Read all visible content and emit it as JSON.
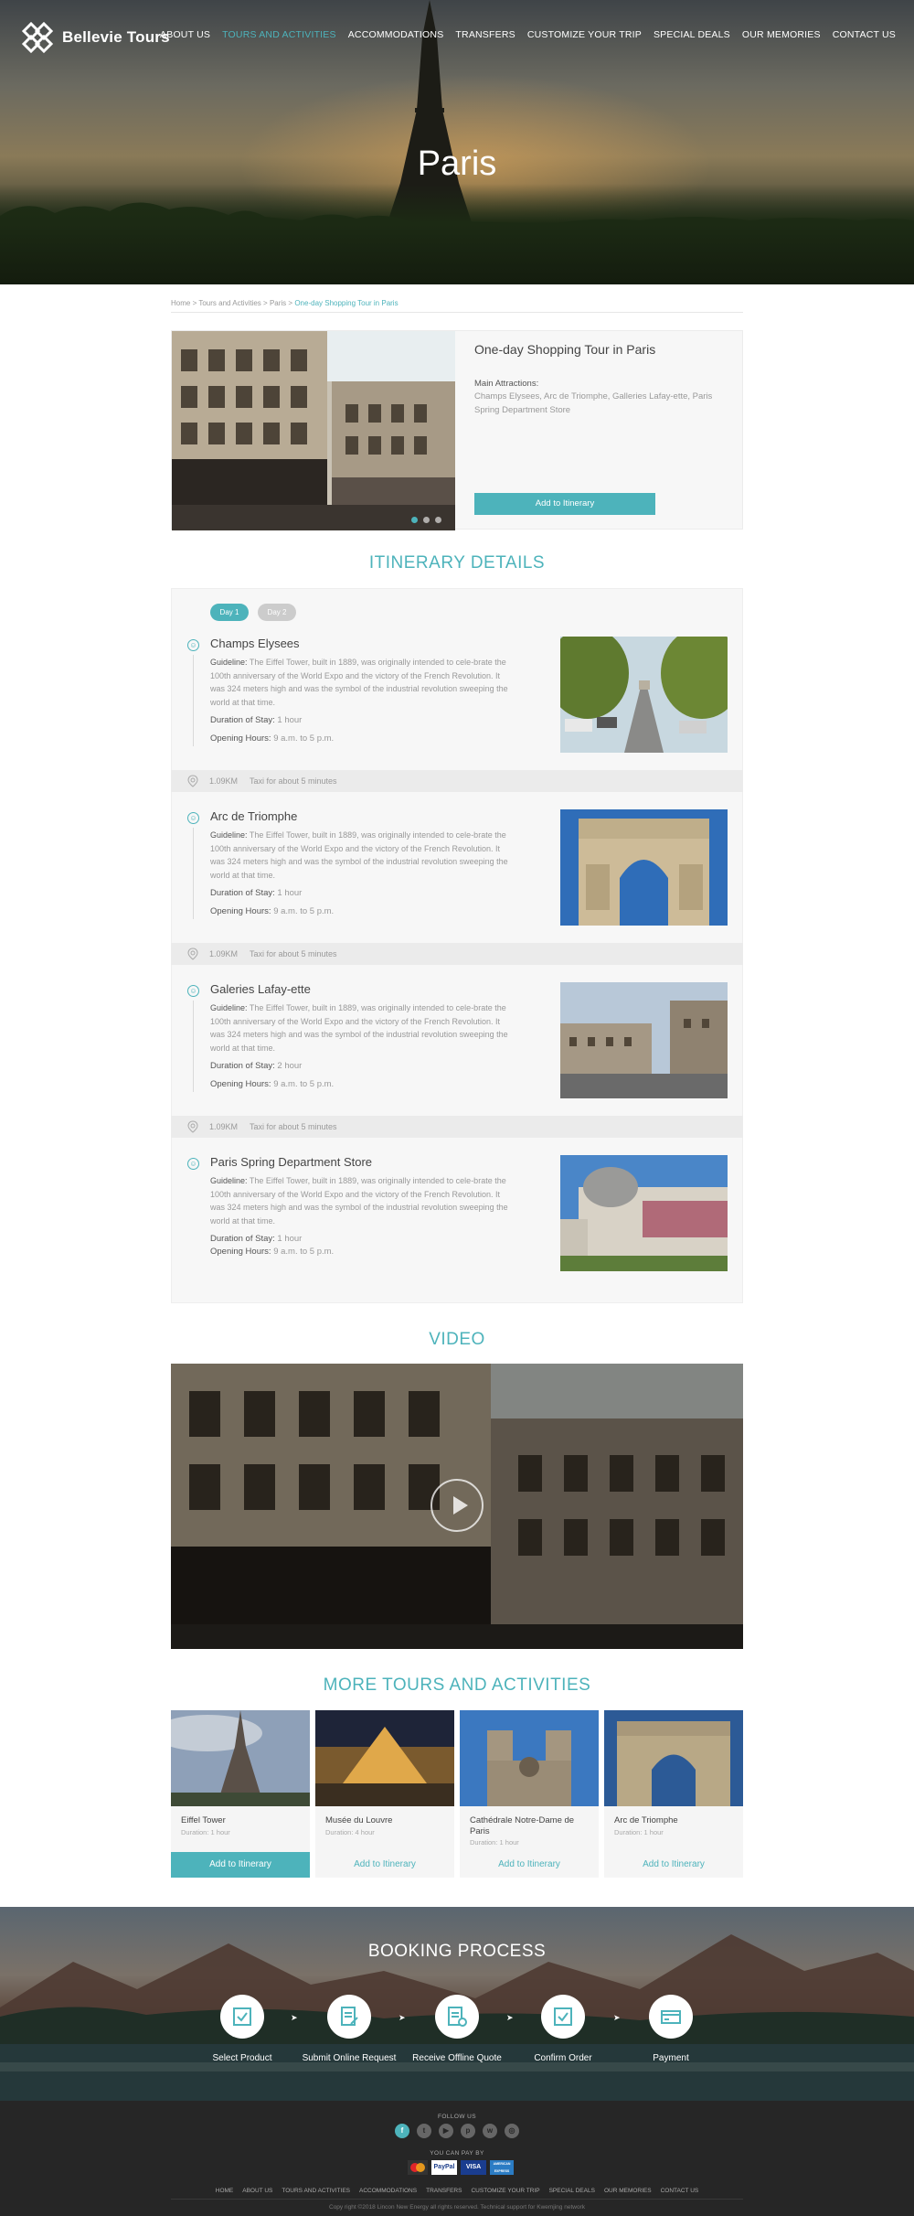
{
  "header": {
    "logo_text": "Bellevie Tours",
    "nav": [
      "ABOUT US",
      "TOURS AND ACTIVITIES",
      "ACCOMMODATIONS",
      "TRANSFERS",
      "CUSTOMIZE YOUR TRIP",
      "SPECIAL DEALS",
      "OUR MEMORIES",
      "CONTACT US"
    ],
    "active_nav": "TOURS AND ACTIVITIES",
    "hero_title": "Paris"
  },
  "breadcrumb": {
    "items": [
      "Home",
      "Tours and Activities",
      "Paris"
    ],
    "current": "One-day Shopping Tour in Paris",
    "separator": ">"
  },
  "product": {
    "title": "One-day Shopping Tour in Paris",
    "attractions_label": "Main Attractions:",
    "attractions": "Champs Elysees, Arc de Triomphe, Galleries Lafay-ette, Paris Spring Department Store",
    "button": "Add to Itinerary"
  },
  "itinerary": {
    "title": "ITINERARY DETAILS",
    "days": [
      "Day 1",
      "Day 2"
    ],
    "guideline_label": "Guideline:",
    "duration_label": "Duration of Stay:",
    "hours_label": "Opening Hours:",
    "stops": [
      {
        "name": "Champs Elysees",
        "guideline": "The Eiffel Tower, built in 1889, was originally intended to cele-brate the 100th anniversary of the World Expo and the victory of the French Revolution. It was 324 meters high and was the symbol of the industrial revolution sweeping the world at that time.",
        "duration": "1 hour",
        "hours": "9 a.m. to 5 p.m."
      },
      {
        "name": "Arc de Triomphe",
        "guideline": "The Eiffel Tower, built in 1889, was originally intended to cele-brate the 100th anniversary of the World Expo and the victory of the French Revolution. It was 324 meters high and was the symbol of the industrial revolution sweeping the world at that time.",
        "duration": "1 hour",
        "hours": "9 a.m. to 5 p.m."
      },
      {
        "name": "Galeries Lafay-ette",
        "guideline": "The Eiffel Tower, built in 1889, was originally intended to cele-brate the 100th anniversary of the World Expo and the victory of the French Revolution. It was 324 meters high and was the symbol of the industrial revolution sweeping the world at that time.",
        "duration": "2 hour",
        "hours": "9 a.m. to 5 p.m."
      },
      {
        "name": "Paris Spring Department Store",
        "guideline": "The Eiffel Tower, built in 1889, was originally intended to cele-brate the 100th anniversary of the World Expo and the victory of the French Revolution. It was 324 meters high and was the symbol of the industrial revolution sweeping the world at that time.",
        "duration": "1 hour",
        "hours": "9 a.m. to 5 p.m."
      }
    ],
    "transits": [
      {
        "distance": "1.09KM",
        "note": "Taxi for about 5 minutes"
      },
      {
        "distance": "1.09KM",
        "note": "Taxi for about 5 minutes"
      },
      {
        "distance": "1.09KM",
        "note": "Taxi for about 5 minutes"
      }
    ]
  },
  "video": {
    "title": "VIDEO"
  },
  "more_tours": {
    "title": "MORE TOURS AND ACTIVITIES",
    "items": [
      {
        "name": "Eiffel Tower",
        "duration": "Duration: 1 hour",
        "button": "Add to Itinerary"
      },
      {
        "name": "Musée du Louvre",
        "duration": "Duration: 4 hour",
        "button": "Add to Itinerary"
      },
      {
        "name": "Cathédrale Notre-Dame de Paris",
        "duration": "Duration: 1 hour",
        "button": "Add to Itinerary"
      },
      {
        "name": "Arc de Triomphe",
        "duration": "Duration: 1 hour",
        "button": "Add to Itinerary"
      }
    ]
  },
  "booking": {
    "title": "BOOKING PROCESS",
    "steps": [
      "Select Product",
      "Submit Online Request",
      "Receive Offline Quote",
      "Confirm Order",
      "Payment"
    ]
  },
  "footer": {
    "follow_us": "FOLLOW US",
    "you_can_pay_by": "YOU CAN PAY BY",
    "nav": [
      "HOME",
      "ABOUT US",
      "TOURS AND ACTIVITIES",
      "ACCOMMODATIONS",
      "TRANSFERS",
      "CUSTOMIZE YOUR TRIP",
      "SPECIAL DEALS",
      "OUR MEMORIES",
      "CONTACT US"
    ],
    "copyright": "Copy right ©2018 Lincon New Energy all rights reserved. Technical support for Kwemjing network",
    "socials": [
      "facebook-icon",
      "twitter-icon",
      "youtube-icon",
      "pinterest-icon",
      "wechat-icon",
      "weibo-icon"
    ],
    "payments": [
      "mastercard",
      "PayPal",
      "VISA",
      "AMERICAN EXPRESS"
    ]
  },
  "colors": {
    "accent": "#4db3bb",
    "footer_bg": "#262626"
  }
}
